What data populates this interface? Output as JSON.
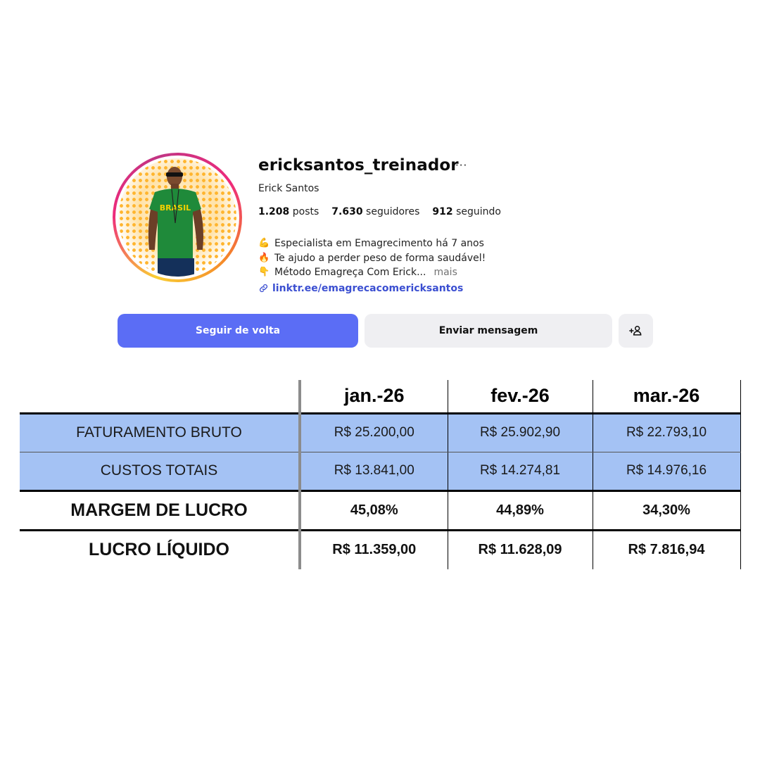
{
  "profile": {
    "username": "ericksantos_treinador",
    "more_icon": "more-horizontal-icon",
    "display_name": "Erick Santos",
    "stats": {
      "posts_count": "1.208",
      "posts_label": "posts",
      "followers_count": "7.630",
      "followers_label": "seguidores",
      "following_count": "912",
      "following_label": "seguindo"
    },
    "bio": [
      {
        "emoji": "💪",
        "icon": "flexed-biceps-icon",
        "text": "Especialista em Emagrecimento há 7 anos"
      },
      {
        "emoji": "🔥",
        "icon": "fire-icon",
        "text": "Te ajudo a perder peso de forma saudável!"
      },
      {
        "emoji": "👇",
        "icon": "pointing-down-icon",
        "text": "Método Emagreça Com Erick...",
        "more": "mais"
      }
    ],
    "link": "linktr.ee/emagrecacomericksantos",
    "avatar_shirt_text": "BRASIL",
    "buttons": {
      "follow_back": "Seguir de volta",
      "send_message": "Enviar mensagem",
      "add_user_icon": "add-user-icon"
    },
    "colors": {
      "follow_button": "#5b6df5",
      "secondary_button": "#efeff2",
      "link": "#3b4fd1"
    }
  },
  "table": {
    "headers": [
      "",
      "jan.-26",
      "fev.-26",
      "mar.-26"
    ],
    "rows": [
      {
        "label": "FATURAMENTO BRUTO",
        "values": [
          "R$ 25.200,00",
          "R$ 25.902,90",
          "R$ 22.793,10"
        ]
      },
      {
        "label": "CUSTOS TOTAIS",
        "values": [
          "R$ 13.841,00",
          "R$ 14.274,81",
          "R$ 14.976,16"
        ]
      },
      {
        "label": "MARGEM DE LUCRO",
        "values": [
          "45,08%",
          "44,89%",
          "34,30%"
        ]
      },
      {
        "label": "LUCRO LÍQUIDO",
        "values": [
          "R$ 11.359,00",
          "R$ 11.628,09",
          "R$ 7.816,94"
        ]
      }
    ],
    "colors": {
      "highlight_rows": "#a4c2f4"
    }
  }
}
